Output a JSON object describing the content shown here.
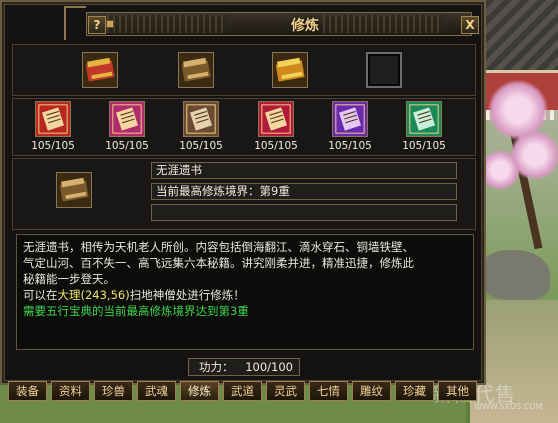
{
  "window": {
    "title": "修炼",
    "help_label": "?",
    "close_label": "X"
  },
  "top_books": [
    {
      "name": "red-gold-book-icon",
      "colors": [
        "#c0382a",
        "#e6b440"
      ]
    },
    {
      "name": "scroll-bundle-icon",
      "colors": [
        "#7a5a2a",
        "#d8b070"
      ]
    },
    {
      "name": "gold-book-icon",
      "colors": [
        "#d08a1c",
        "#f3d25a"
      ]
    },
    {
      "name": "empty-slot-icon",
      "colors": [
        "#1f1f1f",
        "#1f1f1f"
      ]
    }
  ],
  "cultivation_books": [
    {
      "name": "red-scroll-book-icon",
      "colors": [
        "#b8281e",
        "#f4d7a0"
      ],
      "count": "105/105"
    },
    {
      "name": "magenta-scroll-book-icon",
      "colors": [
        "#b02a6e",
        "#f4d7a0"
      ],
      "count": "105/105"
    },
    {
      "name": "brown-scroll-book-icon",
      "colors": [
        "#6a4a30",
        "#e6d2b0"
      ],
      "count": "105/105"
    },
    {
      "name": "crimson-scroll-book-icon",
      "colors": [
        "#b21a3a",
        "#f4d7a0"
      ],
      "count": "105/105"
    },
    {
      "name": "purple-scroll-book-icon",
      "colors": [
        "#6a2ab0",
        "#e4c8f4"
      ],
      "count": "105/105"
    },
    {
      "name": "green-scroll-book-icon",
      "colors": [
        "#1a8a5a",
        "#c8f0d8"
      ],
      "count": "105/105"
    }
  ],
  "selected": {
    "icon": "scroll-bundle-icon",
    "name": "无涯遗书",
    "realm": "当前最高修炼境界：第9重",
    "extra": ""
  },
  "description": {
    "line1": "无涯遗书，相传为天机老人所创。内容包括倒海翻江、滴水穿石、铜墙铁壁、",
    "line2": "气定山河、百不失一、高飞远集六本秘籍。讲究刚柔并进，精准迅捷，修炼此",
    "line3": "秘籍能一步登天。",
    "line4_pre": "可以在",
    "line4_loc": "大理(243,56)",
    "line4_post": "扫地神僧处进行修炼！",
    "line5": "需要五行宝典的当前最高修炼境界达到第3重"
  },
  "power": {
    "label": "功力：",
    "value": "100/100"
  },
  "tabs": [
    {
      "label": "装备",
      "active": false
    },
    {
      "label": "资料",
      "active": false
    },
    {
      "label": "珍兽",
      "active": false
    },
    {
      "label": "武魂",
      "active": false
    },
    {
      "label": "修炼",
      "active": true
    },
    {
      "label": "武道",
      "active": false
    },
    {
      "label": "灵武",
      "active": false
    },
    {
      "label": "七情",
      "active": false
    },
    {
      "label": "雕纹",
      "active": false
    },
    {
      "label": "珍藏",
      "active": false
    },
    {
      "label": "其他",
      "active": false
    }
  ],
  "watermark": {
    "main": "新仙代售",
    "sub": "WWW.SXDS.COM"
  }
}
